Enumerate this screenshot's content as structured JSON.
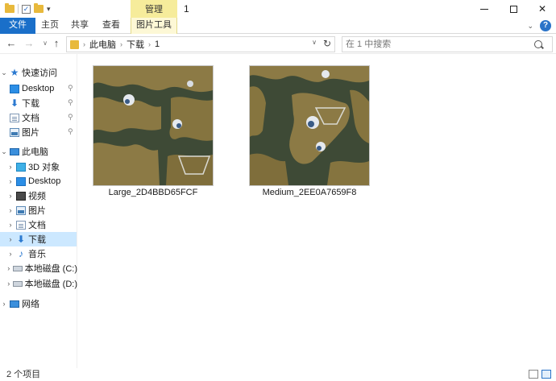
{
  "titlebar": {
    "title": "1",
    "context_tab_group": "管理",
    "quick_access_icons": [
      "folder-icon",
      "properties-check-icon",
      "new-folder-icon",
      "qat-dropdown-icon"
    ]
  },
  "ribbon": {
    "tabs": [
      {
        "label": "文件",
        "active": true,
        "accent": "#1a6fc9"
      },
      {
        "label": "主页"
      },
      {
        "label": "共享"
      },
      {
        "label": "查看"
      },
      {
        "label": "图片工具",
        "context": true,
        "accent": "#f6ec9b"
      }
    ]
  },
  "nav": {
    "breadcrumb": [
      "此电脑",
      "下载",
      "1"
    ],
    "search_placeholder": "在 1 中搜索"
  },
  "sidebar": {
    "quick_access": {
      "label": "快速访问",
      "items": [
        {
          "label": "Desktop",
          "icon": "desktop-icon",
          "pinned": true
        },
        {
          "label": "下载",
          "icon": "download-icon",
          "pinned": true
        },
        {
          "label": "文档",
          "icon": "document-icon",
          "pinned": true
        },
        {
          "label": "图片",
          "icon": "picture-icon",
          "pinned": true
        }
      ]
    },
    "this_pc": {
      "label": "此电脑",
      "items": [
        {
          "label": "3D 对象",
          "icon": "3d-objects-icon"
        },
        {
          "label": "Desktop",
          "icon": "desktop-icon"
        },
        {
          "label": "视频",
          "icon": "video-icon"
        },
        {
          "label": "图片",
          "icon": "picture-icon"
        },
        {
          "label": "文档",
          "icon": "document-icon"
        },
        {
          "label": "下载",
          "icon": "download-icon",
          "selected": true
        },
        {
          "label": "音乐",
          "icon": "music-icon"
        },
        {
          "label": "本地磁盘 (C:)",
          "icon": "disk-icon"
        },
        {
          "label": "本地磁盘 (D:)",
          "icon": "disk-icon"
        }
      ]
    },
    "network": {
      "label": "网络",
      "icon": "network-icon"
    }
  },
  "files": [
    {
      "name": "Large_2D4BBD65FCF",
      "icon": "map-thumbnail"
    },
    {
      "name": "Medium_2EE0A7659F8",
      "icon": "map-thumbnail"
    }
  ],
  "status": {
    "item_count": "2 个项目"
  },
  "colors": {
    "selection": "#cce8ff",
    "file_tab": "#1a6fc9",
    "context_tab": "#f6ec9b",
    "map_water": "#3e4a36",
    "map_land": "#8c7a45"
  }
}
